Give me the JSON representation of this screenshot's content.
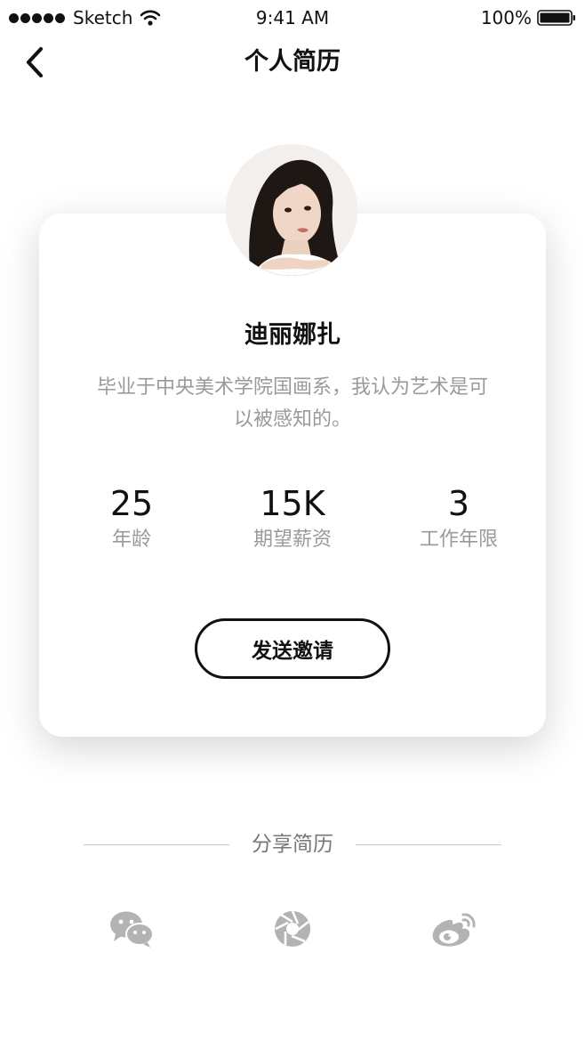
{
  "status_bar": {
    "carrier": "Sketch",
    "time": "9:41 AM",
    "battery": "100%",
    "icons": [
      "signal-dots-icon",
      "wifi-icon",
      "battery-icon"
    ]
  },
  "nav": {
    "title": "个人简历",
    "back_icon": "chevron-left-icon"
  },
  "profile": {
    "name": "迪丽娜扎",
    "bio": "毕业于中央美术学院国画系，我认为艺术是可以被感知的。",
    "stats": [
      {
        "value": "25",
        "label": "年龄"
      },
      {
        "value": "15K",
        "label": "期望薪资"
      },
      {
        "value": "3",
        "label": "工作年限"
      }
    ],
    "invite_label": "发送邀请"
  },
  "share": {
    "title": "分享简历",
    "icons": [
      "wechat-icon",
      "moments-icon",
      "weibo-icon"
    ],
    "icon_color": "#b3b3b3"
  },
  "colors": {
    "text_primary": "#111111",
    "text_secondary": "#9a9a9a",
    "divider": "#c8c8c8"
  }
}
